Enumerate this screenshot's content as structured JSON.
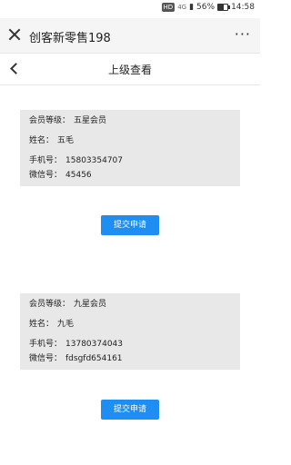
{
  "status_bar": {
    "hd": "HD",
    "signal": "4G",
    "battery_percent": "56%",
    "time": "14:58",
    "battery_level": 0.56
  },
  "wx_header": {
    "title": "创客新零售198",
    "more_label": "···"
  },
  "nav": {
    "title": "上级查看"
  },
  "cards": [
    {
      "level_label": "会员等级：",
      "level_value": "五星会员",
      "name_label": "姓名：",
      "name_value": "五毛",
      "phone_label": "手机号：",
      "phone_value": "15803354707",
      "wechat_label": "微信号：",
      "wechat_value": "45456",
      "button_label": "提交申请"
    },
    {
      "level_label": "会员等级：",
      "level_value": "九星会员",
      "name_label": "姓名：",
      "name_value": "九毛",
      "phone_label": "手机号：",
      "phone_value": "13780374043",
      "wechat_label": "微信号：",
      "wechat_value": "fdsgfd654161",
      "button_label": "提交申请"
    }
  ]
}
